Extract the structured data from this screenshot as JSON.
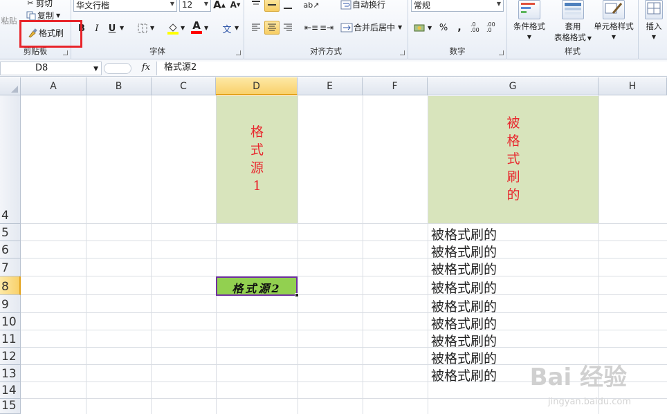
{
  "ribbon": {
    "clipboard": {
      "label": "剪贴板",
      "paste_label": "粘贴",
      "cut_label": "剪切",
      "copy_label": "复制",
      "format_painter_label": "格式刷"
    },
    "font": {
      "label": "字体",
      "font_name": "华文行楷",
      "font_size": "12",
      "bold": "B",
      "italic": "I",
      "underline": "U",
      "grow_font": "A",
      "shrink_font": "A",
      "font_color_letter": "A",
      "phonetic": "文"
    },
    "alignment": {
      "label": "对齐方式",
      "wrap_text_label": "自动换行",
      "merge_center_label": "合并后居中"
    },
    "number": {
      "label": "数字",
      "format_value": "常规",
      "percent_label": "%",
      "comma_label": ",",
      "inc_decimal": ".0 .00",
      "dec_decimal": ".00 .0"
    },
    "styles": {
      "label": "样式",
      "conditional_label": "条件格式",
      "table_format_line1": "套用",
      "table_format_line2": "表格格式",
      "cell_styles_label": "单元格样式"
    },
    "cells": {
      "insert_label": "插入"
    }
  },
  "formula_bar": {
    "name_box": "D8",
    "fx": "fx",
    "content": "格式源2"
  },
  "sheet": {
    "columns": [
      "A",
      "B",
      "C",
      "D",
      "E",
      "F",
      "G",
      "H"
    ],
    "rows": [
      "4",
      "5",
      "6",
      "7",
      "8",
      "9",
      "10",
      "11",
      "12",
      "13",
      "14",
      "15"
    ],
    "d4_chars": [
      "格",
      "式",
      "源",
      "1"
    ],
    "g4_chars": [
      "被",
      "格",
      "式",
      "刷",
      "的"
    ],
    "g_cells": [
      "被格式刷的",
      "被格式刷的",
      "被格式刷的",
      "被格式刷的",
      "被格式刷的",
      "被格式刷的",
      "被格式刷的",
      "被格式刷的",
      "被格式刷的"
    ],
    "d8_value": "格式源2"
  },
  "watermark": {
    "main": "Bai 经验",
    "sub": "jingyan.baidu.com"
  }
}
